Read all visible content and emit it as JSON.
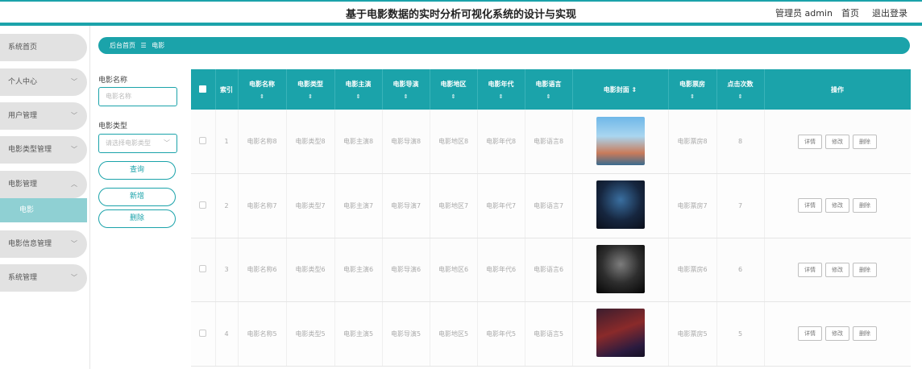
{
  "header": {
    "title": "基于电影数据的实时分析可视化系统的设计与实现",
    "admin": "管理员 admin",
    "back": "首页",
    "logout": "退出登录"
  },
  "sidebar": {
    "items": [
      {
        "label": "系统首页"
      },
      {
        "label": "个人中心"
      },
      {
        "label": "用户管理"
      },
      {
        "label": "电影类型管理"
      },
      {
        "label": "电影管理"
      },
      {
        "label": "电影信息管理"
      },
      {
        "label": "系统管理"
      }
    ],
    "sub_active": "电影"
  },
  "breadcrumb": {
    "home": "后台首页",
    "sep": "☰",
    "current": "电影"
  },
  "filters": {
    "name_label": "电影名称",
    "name_placeholder": "电影名称",
    "type_label": "电影类型",
    "type_placeholder": "请选择电影类型",
    "query_button": "查询",
    "add_button": "新增",
    "delete_button": "删除"
  },
  "table": {
    "headers": [
      "索引",
      "电影名称",
      "电影类型",
      "电影主演",
      "电影导演",
      "电影地区",
      "电影年代",
      "电影语言",
      "电影封面",
      "电影票房",
      "点击次数",
      "操作"
    ],
    "sort_glyph": "⇕",
    "rows": [
      {
        "index": "1",
        "name": "电影名称8",
        "type": "电影类型8",
        "actor": "电影主演8",
        "director": "电影导演8",
        "region": "电影地区8",
        "year": "电影年代8",
        "lang": "电影语言8",
        "box": "电影票房8",
        "clicks": "8"
      },
      {
        "index": "2",
        "name": "电影名称7",
        "type": "电影类型7",
        "actor": "电影主演7",
        "director": "电影导演7",
        "region": "电影地区7",
        "year": "电影年代7",
        "lang": "电影语言7",
        "box": "电影票房7",
        "clicks": "7"
      },
      {
        "index": "3",
        "name": "电影名称6",
        "type": "电影类型6",
        "actor": "电影主演6",
        "director": "电影导演6",
        "region": "电影地区6",
        "year": "电影年代6",
        "lang": "电影语言6",
        "box": "电影票房6",
        "clicks": "6"
      },
      {
        "index": "4",
        "name": "电影名称5",
        "type": "电影类型5",
        "actor": "电影主演5",
        "director": "电影导演5",
        "region": "电影地区5",
        "year": "电影年代5",
        "lang": "电影语言5",
        "box": "电影票房5",
        "clicks": "5"
      }
    ],
    "actions": {
      "detail": "详情",
      "edit": "修改",
      "delete": "删除"
    }
  },
  "colors": {
    "accent": "#1ba3aa",
    "sidebar_active": "#8fd0d3",
    "menu_bg": "#e2e2e2"
  }
}
